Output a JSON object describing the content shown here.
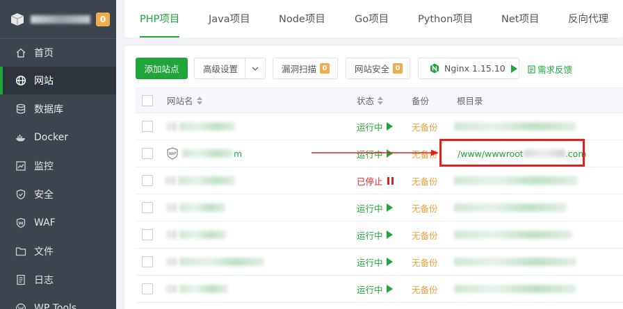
{
  "sidebar": {
    "badge": "0",
    "items": [
      {
        "label": "首页",
        "icon": "home-icon",
        "name": "home"
      },
      {
        "label": "网站",
        "icon": "globe-icon",
        "name": "website",
        "active": true
      },
      {
        "label": "数据库",
        "icon": "database-icon",
        "name": "database"
      },
      {
        "label": "Docker",
        "icon": "docker-icon",
        "name": "docker"
      },
      {
        "label": "监控",
        "icon": "monitor-icon",
        "name": "monitor"
      },
      {
        "label": "安全",
        "icon": "shield-icon",
        "name": "security"
      },
      {
        "label": "WAF",
        "icon": "waf-icon",
        "name": "waf"
      },
      {
        "label": "文件",
        "icon": "folder-icon",
        "name": "files"
      },
      {
        "label": "日志",
        "icon": "log-icon",
        "name": "logs"
      },
      {
        "label": "WP Tools",
        "icon": "wp-icon",
        "name": "wp-tools"
      }
    ]
  },
  "tabs": [
    {
      "label": "PHP项目",
      "active": true
    },
    {
      "label": "Java项目"
    },
    {
      "label": "Node项目"
    },
    {
      "label": "Go项目"
    },
    {
      "label": "Python项目"
    },
    {
      "label": "Net项目"
    },
    {
      "label": "反向代理"
    }
  ],
  "toolbar": {
    "add_site": "添加站点",
    "advanced": "高级设置",
    "scan": "漏洞扫描",
    "scan_count": "0",
    "site_security": "网站安全",
    "security_count": "0",
    "nginx": "Nginx 1.15.10",
    "feedback": "需求反馈"
  },
  "table": {
    "headers": {
      "name": "网站名",
      "status": "状态",
      "backup": "备份",
      "root": "根目录"
    },
    "rows": [
      {
        "status": "运行中",
        "state": "running",
        "backup": "无备份"
      },
      {
        "name_tail": "m",
        "waf": true,
        "status": "运行中",
        "state": "running",
        "backup": "无备份",
        "root_head": "/www/wwwroot",
        "root_tail": ".com"
      },
      {
        "status": "已停止",
        "state": "stopped",
        "backup": "无备份"
      },
      {
        "status": "运行中",
        "state": "running",
        "backup": "无备份"
      },
      {
        "status": "运行中",
        "state": "running",
        "backup": "无备份"
      },
      {
        "status": "运行中",
        "state": "running",
        "backup": "无备份"
      },
      {
        "status": "运行中",
        "state": "running",
        "backup": "无备份"
      }
    ]
  },
  "colors": {
    "accent": "#20a53a",
    "warning": "#f0ad4e",
    "danger": "#e02020",
    "sidebar": "#3c444d"
  }
}
